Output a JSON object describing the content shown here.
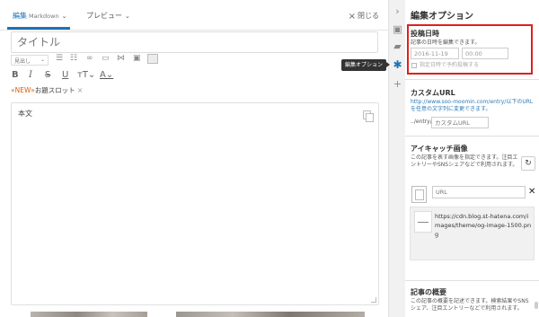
{
  "editor": {
    "tab_edit": "編集",
    "tab_edit_mode": "Markdown",
    "tab_preview": "プレビュー",
    "close_label": "閉じる",
    "title_placeholder": "タイトル",
    "heading_select": "見出し",
    "keyword_new": "«NEW»",
    "keyword_text": "お題スロット",
    "body_placeholder": "本文"
  },
  "tooltip": "編集オプション",
  "options": {
    "title": "編集オプション",
    "post_date": {
      "heading": "投稿日時",
      "description": "記事の日時を編集できます。",
      "date_value": "2016-11-19",
      "time_value": "00:00",
      "schedule_label": "指定日時で予約投稿する"
    },
    "custom_url": {
      "heading": "カスタムURL",
      "description": "http://www.soo-moomin.com/entry/以下のURLを任意の文字列に変更できます。",
      "prefix": "../entry/",
      "placeholder": "カスタムURL"
    },
    "eyecatch": {
      "heading": "アイキャッチ画像",
      "description": "この記事を表す画像を指定できます。注目エントリーやSNSシェアなどで利用されます。",
      "url_placeholder": "URL",
      "image_url": "https://cdn.blog.st-hatena.com/images/theme/og-image-1500.png"
    },
    "summary": {
      "heading": "記事の概要",
      "description": "この記事の概要を記述できます。検索結果やSNSシェア、注目エントリーなどで利用されます。"
    }
  },
  "colors": {
    "accent": "#1c72b8",
    "highlight": "#e01f1f",
    "new_tag": "#e05a00"
  }
}
